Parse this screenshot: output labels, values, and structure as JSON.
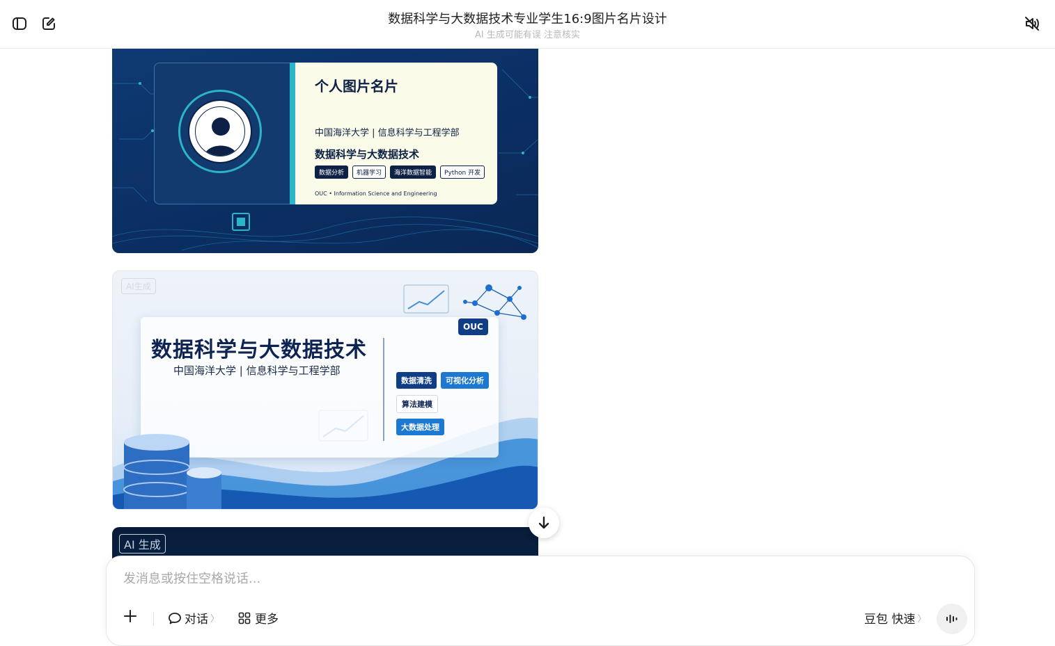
{
  "header": {
    "title": "数据科学与大数据技术专业学生16:9图片名片设计",
    "subtitle": "AI 生成可能有误 注意核实",
    "icons": [
      "sidebar-toggle-icon",
      "new-chat-icon",
      "mute-icon"
    ]
  },
  "card1": {
    "name": "个人图片名片",
    "org": "中国海洋大学 | 信息科学与工程学部",
    "major": "数据科学与大数据技术",
    "tags": [
      "数据分析",
      "机器学习",
      "海洋数据智能",
      "Python 开发"
    ],
    "footer": "OUC • Information Science and Engineering"
  },
  "card2": {
    "watermark": "AI生成",
    "title": "数据科学与大数据技术",
    "subtitle": "中国海洋大学 | 信息科学与工程学部",
    "badge": "OUC",
    "tags": [
      "数据清洗",
      "可视化分析",
      "算法建模",
      "大数据处理"
    ]
  },
  "card3": {
    "watermark": "AI 生成"
  },
  "composer": {
    "placeholder": "发消息或按住空格说话...",
    "dialog_label": "对话",
    "more_label": "更多",
    "model_label": "豆包 快速",
    "chevron": "〉"
  }
}
